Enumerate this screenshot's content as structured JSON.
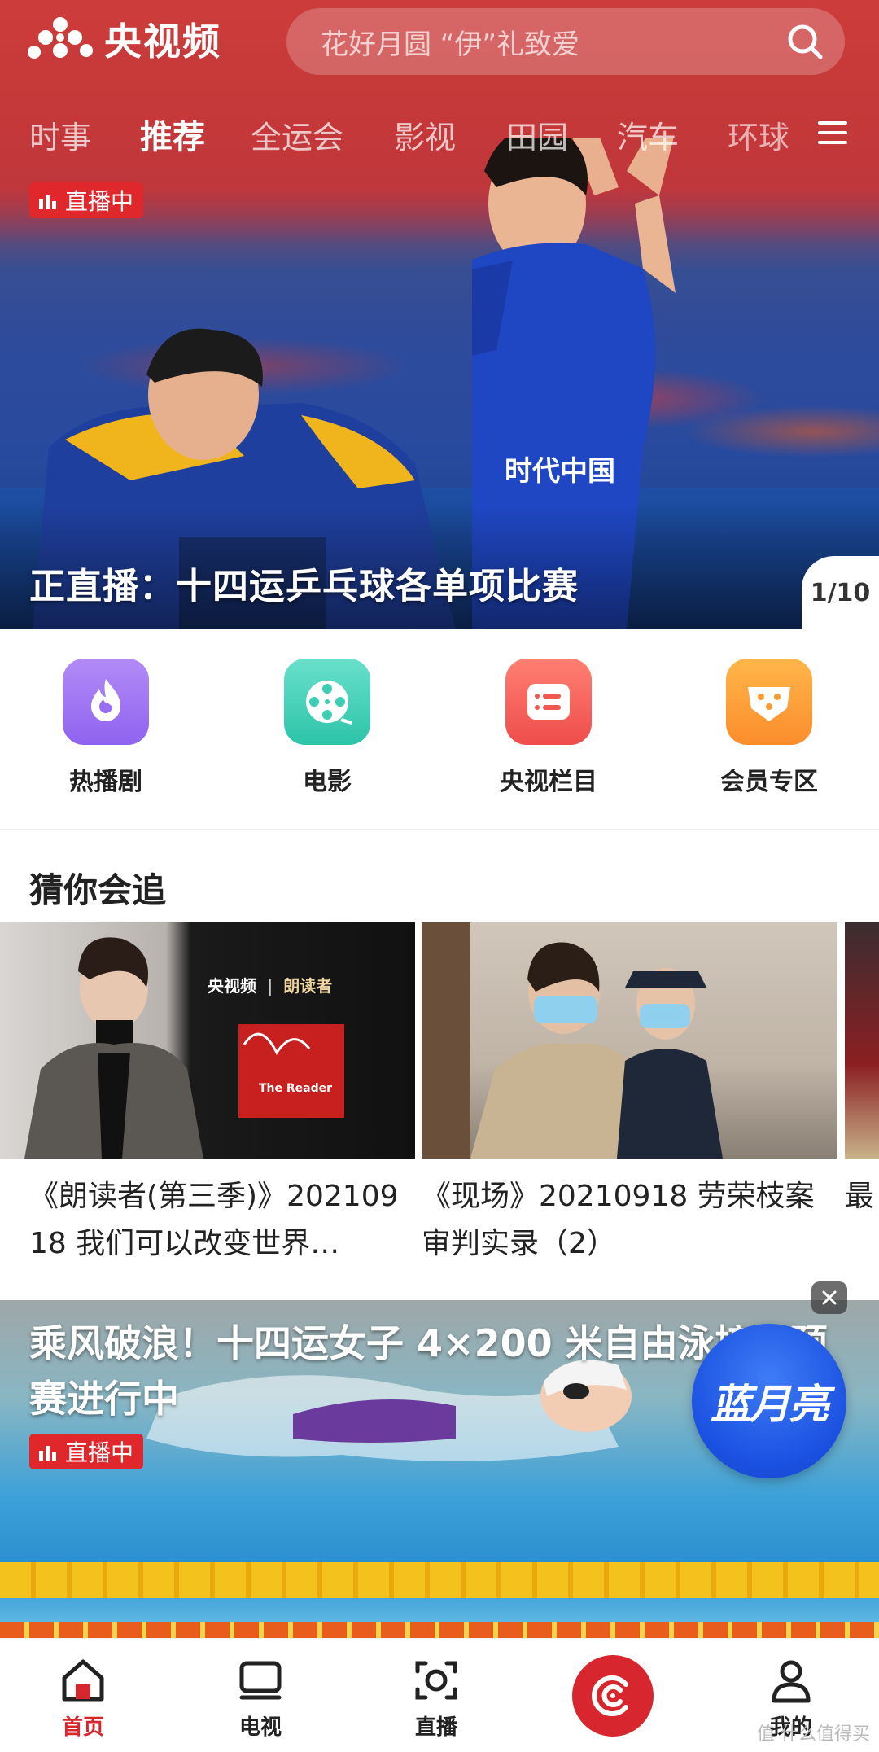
{
  "header": {
    "app_name": "央视频",
    "search_placeholder": "花好月圆 “伊”礼致爱",
    "tabs": [
      {
        "label": "时事"
      },
      {
        "label": "推荐",
        "active": true
      },
      {
        "label": "全运会"
      },
      {
        "label": "影视"
      },
      {
        "label": "田园"
      },
      {
        "label": "汽车"
      },
      {
        "label": "环球"
      }
    ],
    "menu_icon": "hamburger-icon"
  },
  "hero": {
    "badge": "直播中",
    "title": "正直播：十四运乒乓球各单项比赛",
    "pager": "1/10",
    "jersey_text": "时代中国"
  },
  "quick_entries": [
    {
      "label": "热播剧",
      "icon": "flame-icon",
      "color_top": "#b28bf6",
      "color_bottom": "#8f63f0"
    },
    {
      "label": "电影",
      "icon": "film-reel-icon",
      "color_top": "#69e0cb",
      "color_bottom": "#2cc4a9"
    },
    {
      "label": "央视栏目",
      "icon": "list-icon",
      "color_top": "#ff7f72",
      "color_bottom": "#ef4d4b"
    },
    {
      "label": "会员专区",
      "icon": "vip-icon",
      "color_top": "#ffb64a",
      "color_bottom": "#fb8d2b"
    }
  ],
  "guess": {
    "title": "猜你会追",
    "cards": [
      {
        "title": "《朗读者(第三季)》20210918 我们可以改变世界…",
        "thumb_brand": "央视频",
        "thumb_show": "朗读者",
        "thumb_en": "The Reader"
      },
      {
        "title": "《现场》20210918 劳荣枝案审判实录（2）"
      },
      {
        "title": "最"
      }
    ]
  },
  "swim_banner": {
    "title": "乘风破浪！十四运女子 4×200 米自由泳接力预赛进行中",
    "badge": "直播中",
    "brand": "蓝月亮"
  },
  "bottom_nav": [
    {
      "label": "首页",
      "icon": "home-icon",
      "active": true
    },
    {
      "label": "电视",
      "icon": "tv-icon"
    },
    {
      "label": "直播",
      "icon": "live-camera-icon"
    },
    {
      "label": "",
      "icon": "cctv-center-icon"
    },
    {
      "label": "我的",
      "icon": "user-icon"
    }
  ],
  "watermark": "值 什么值得买",
  "colors": {
    "brand_red": "#d7262d",
    "live_red": "#e0272b"
  }
}
